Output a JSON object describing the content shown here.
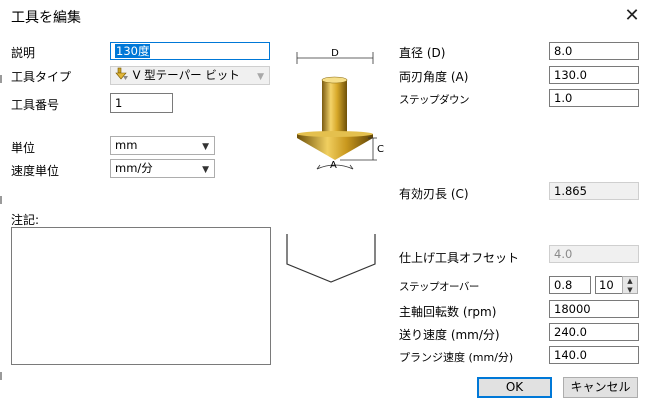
{
  "window": {
    "title": "工具を編集",
    "close_glyph": "✕"
  },
  "left": {
    "description_label": "説明",
    "description_value": "130度",
    "tool_type_label": "工具タイプ",
    "tool_type_value": "V 型テーパー ビット",
    "tool_number_label": "工具番号",
    "tool_number_value": "1",
    "unit_label": "単位",
    "unit_value": "mm",
    "speed_unit_label": "速度単位",
    "speed_unit_value": "mm/分",
    "notes_label": "注記:",
    "notes_value": ""
  },
  "diagram": {
    "d_label": "D",
    "c_label": "C",
    "a_label": "A"
  },
  "right": {
    "diameter_label": "直径 (D)",
    "diameter_value": "8.0",
    "angle_label": "両刃角度 (A)",
    "angle_value": "130.0",
    "stepdown_label": "ステップダウン",
    "stepdown_value": "1.0",
    "flute_length_label": "有効刃長 (C)",
    "flute_length_value": "1.865",
    "finish_offset_label": "仕上げ工具オフセット",
    "finish_offset_value": "4.0",
    "stepover_label": "ステップオーバー",
    "stepover_value": "0.8",
    "stepover_percent": "10",
    "spindle_label": "主軸回転数 (rpm)",
    "spindle_value": "18000",
    "feed_label": "送り速度 (mm/分)",
    "feed_value": "240.0",
    "plunge_label": "プランジ速度 (mm/分)",
    "plunge_value": "140.0"
  },
  "buttons": {
    "ok": "OK",
    "cancel": "キャンセル"
  },
  "icons": {
    "tool_type_icon": "v-bit-icon",
    "dropdown_arrow": "chevron-down-icon",
    "spin_up": "spin-up-icon",
    "spin_down": "spin-down-icon"
  }
}
